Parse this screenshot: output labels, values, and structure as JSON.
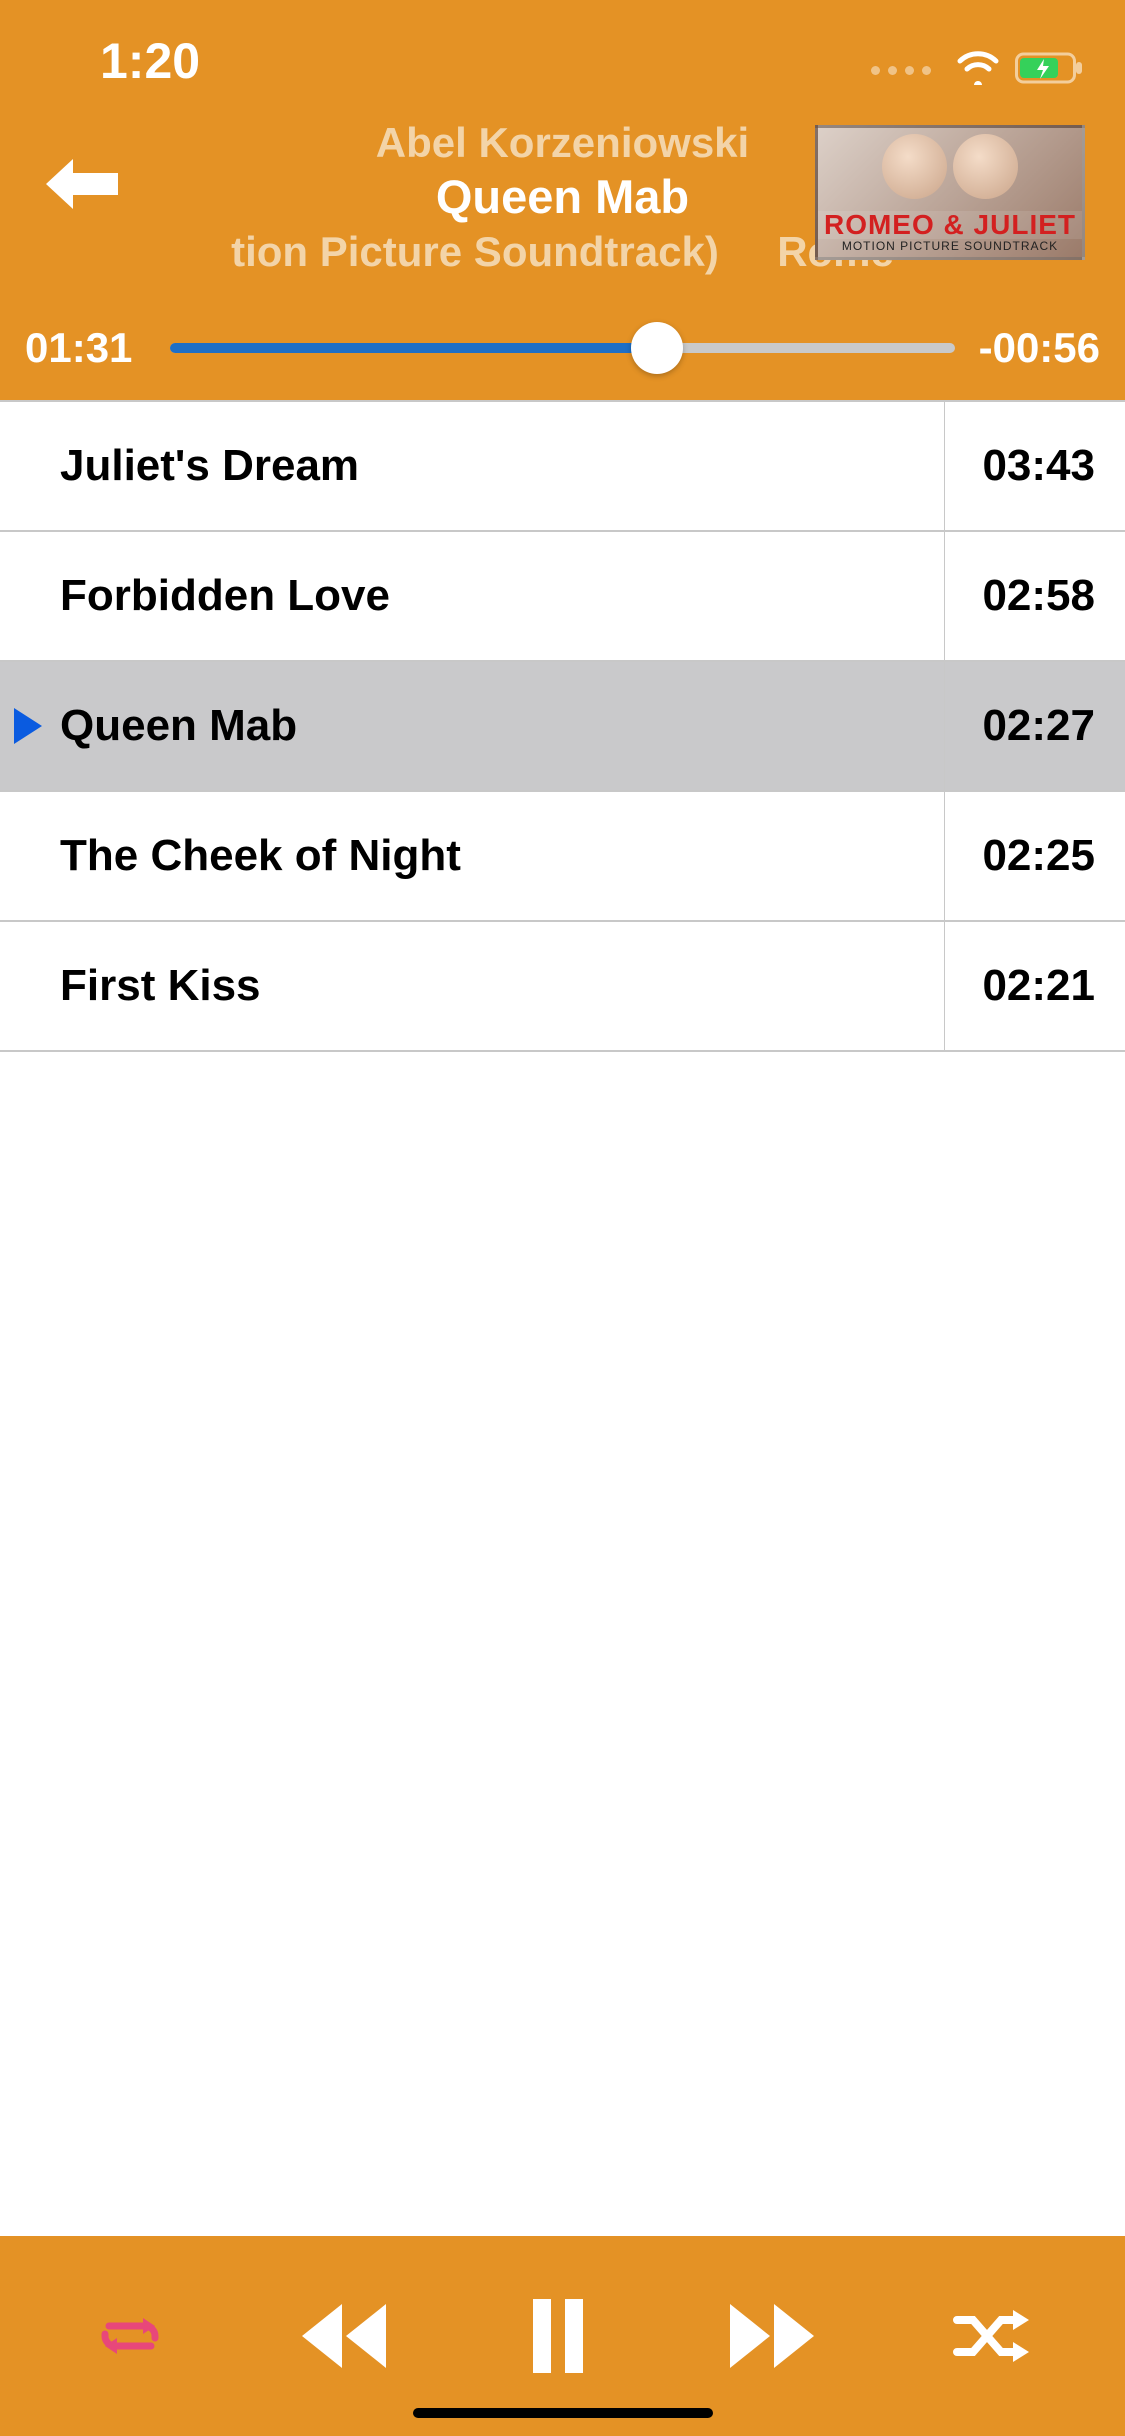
{
  "status": {
    "time": "1:20"
  },
  "header": {
    "artist": "Abel Korzeniowski",
    "title": "Queen Mab",
    "album_line_left": "tion Picture Soundtrack)",
    "album_line_right": "Rome",
    "art_title": "ROMEO & JULIET",
    "art_sub": "MOTION PICTURE SOUNDTRACK"
  },
  "progress": {
    "elapsed": "01:31",
    "remaining": "-00:56",
    "percent": 62
  },
  "tracks": [
    {
      "title": "Juliet's Dream",
      "duration": "03:43",
      "playing": false
    },
    {
      "title": "Forbidden Love",
      "duration": "02:58",
      "playing": false
    },
    {
      "title": "Queen Mab",
      "duration": "02:27",
      "playing": true
    },
    {
      "title": "The Cheek of Night",
      "duration": "02:25",
      "playing": false
    },
    {
      "title": "First Kiss",
      "duration": "02:21",
      "playing": false
    }
  ],
  "controls": {
    "repeat": "repeat",
    "prev": "previous",
    "pause": "pause",
    "next": "next",
    "shuffle": "shuffle"
  }
}
